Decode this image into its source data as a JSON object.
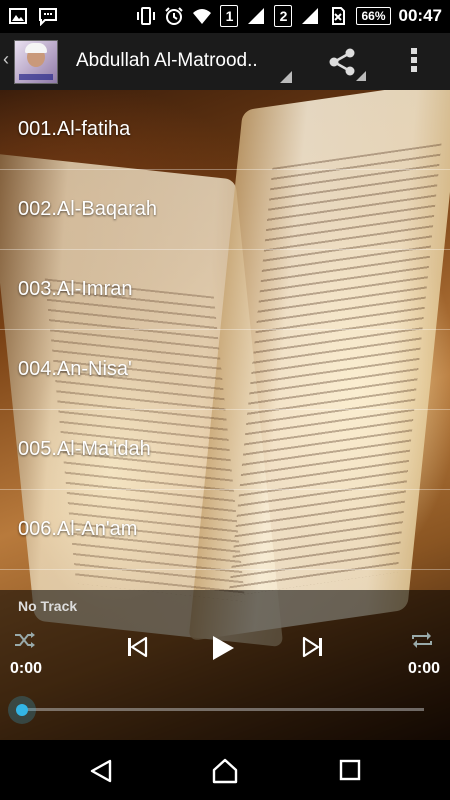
{
  "status_bar": {
    "sim1": "1",
    "sim2": "2",
    "battery": "66%",
    "time": "00:47"
  },
  "action_bar": {
    "title": "Abdullah Al-Matrood..",
    "icons": [
      "back-chevron-icon",
      "app-avatar",
      "share-icon",
      "overflow-menu-icon"
    ]
  },
  "tracks": [
    {
      "label": "001.Al-fatiha"
    },
    {
      "label": "002.Al-Baqarah"
    },
    {
      "label": "003.Al-Imran"
    },
    {
      "label": "004.An-Nisa'"
    },
    {
      "label": "005.Al-Ma'idah"
    },
    {
      "label": "006.Al-An'am"
    }
  ],
  "player": {
    "now_playing": "No Track",
    "time_elapsed": "0:00",
    "time_total": "0:00",
    "progress": 0,
    "accent_color": "#33b5e5",
    "icons": [
      "shuffle-icon",
      "previous-icon",
      "play-icon",
      "next-icon",
      "repeat-icon"
    ]
  },
  "navigation_bar": {
    "icons": [
      "back-icon",
      "home-icon",
      "recents-icon"
    ]
  }
}
